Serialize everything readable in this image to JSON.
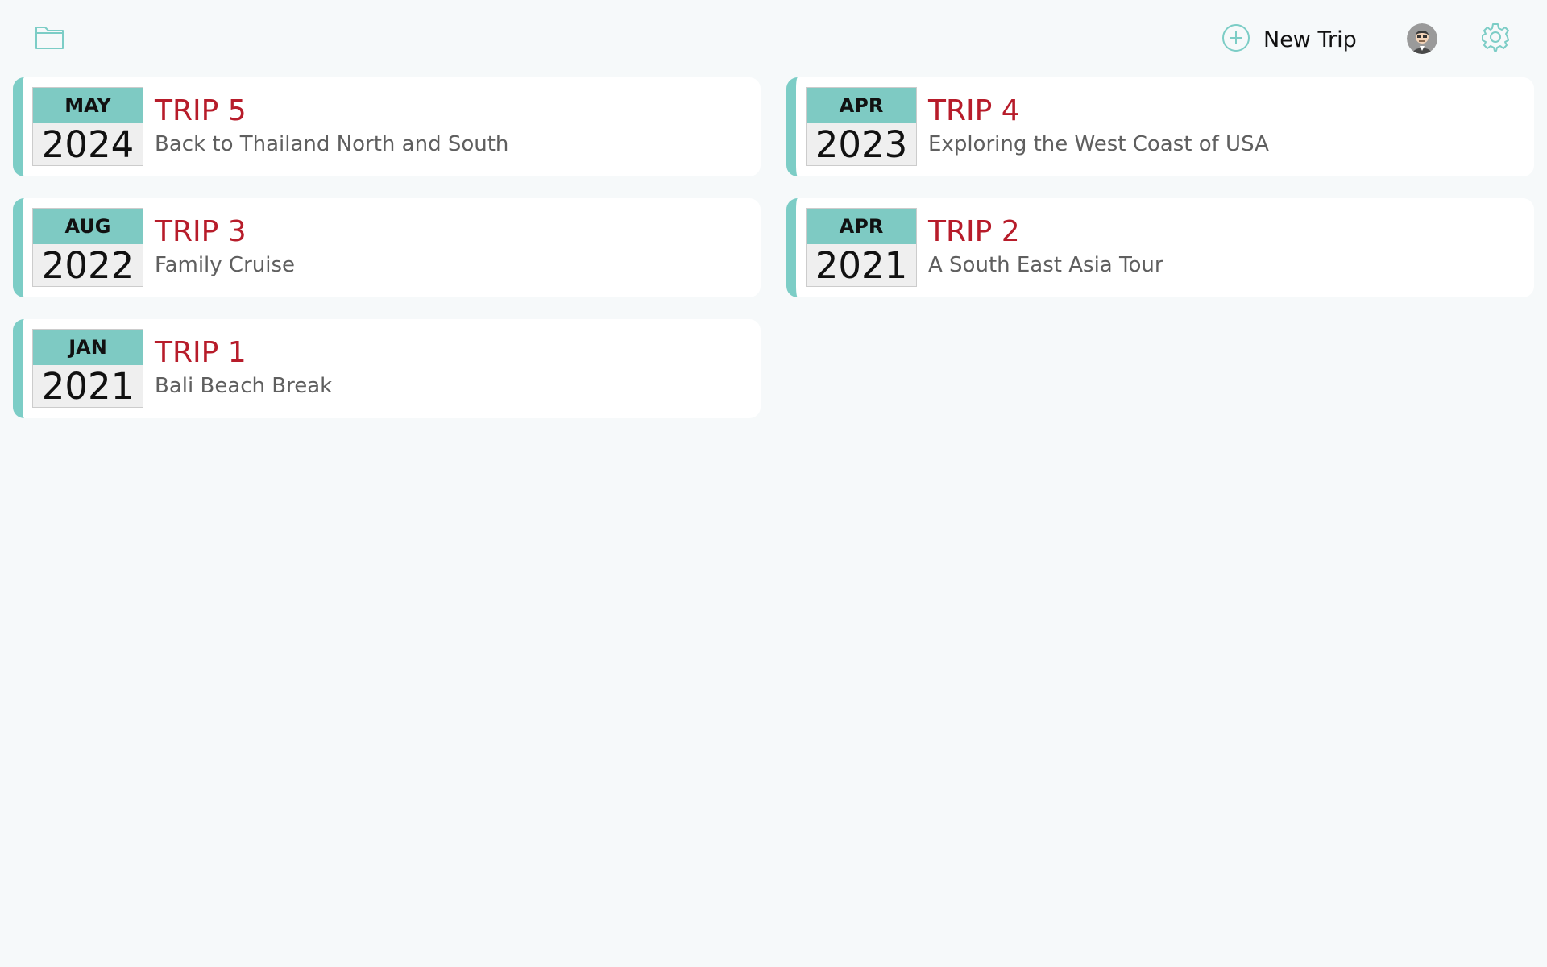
{
  "toolbar": {
    "new_trip_label": "New Trip",
    "folder_icon": "folder-icon",
    "add_icon": "plus-circle-icon",
    "avatar_icon": "user-avatar",
    "settings_icon": "gear-icon"
  },
  "colors": {
    "accent": "#7ecac3",
    "title": "#b71c2a",
    "subtitle": "#5f5f5f",
    "background": "#f6f9fa"
  },
  "trips": [
    {
      "month": "MAY",
      "year": "2024",
      "title": "TRIP 5",
      "subtitle": "Back to Thailand North and South"
    },
    {
      "month": "APR",
      "year": "2023",
      "title": "TRIP 4",
      "subtitle": "Exploring the West Coast of USA"
    },
    {
      "month": "AUG",
      "year": "2022",
      "title": "TRIP 3",
      "subtitle": "Family Cruise"
    },
    {
      "month": "APR",
      "year": "2021",
      "title": "TRIP 2",
      "subtitle": "A South East Asia Tour"
    },
    {
      "month": "JAN",
      "year": "2021",
      "title": "TRIP 1",
      "subtitle": "Bali Beach Break"
    }
  ]
}
